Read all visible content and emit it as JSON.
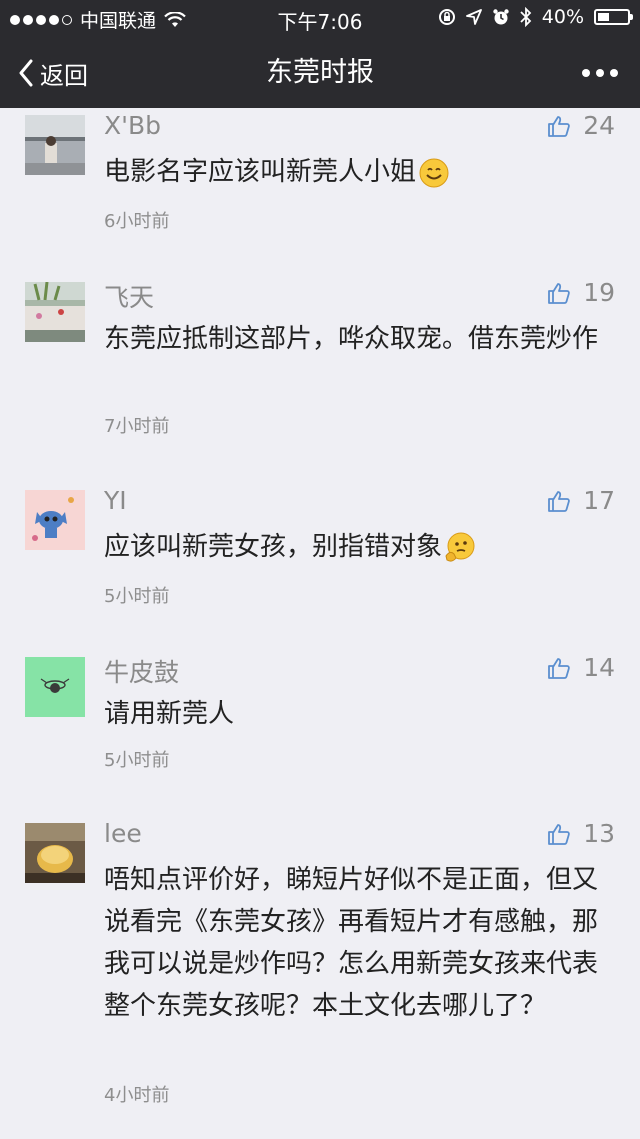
{
  "status_bar": {
    "carrier": "中国联通",
    "time": "下午7:06",
    "battery": "40%",
    "battery_level": 0.4
  },
  "nav": {
    "back_label": "返回",
    "title": "东莞时报",
    "icons": [
      "chevron-left-icon",
      "more-icon"
    ]
  },
  "comments": [
    {
      "name": "X'Bb",
      "likes": "24",
      "text": "电影名字应该叫新莞人小姐",
      "emoji": "smile-emoji",
      "time": "6小时前"
    },
    {
      "name": "飞天",
      "likes": "19",
      "text": "东莞应抵制这部片，哗众取宠。借东莞炒作",
      "time": "7小时前"
    },
    {
      "name": "YI",
      "likes": "17",
      "text": "应该叫新莞女孩，别指错对象",
      "emoji": "thinking-emoji",
      "time": "5小时前"
    },
    {
      "name": "牛皮鼓",
      "likes": "14",
      "text": "请用新莞人",
      "time": "5小时前"
    },
    {
      "name": "lee",
      "likes": "13",
      "text": "唔知点评价好，睇短片好似不是正面，但又说看完《东莞女孩》再看短片才有感触，那我可以说是炒作吗？怎么用新莞女孩来代表整个东莞女孩呢？本土文化去哪儿了？",
      "time": "4小时前"
    }
  ]
}
